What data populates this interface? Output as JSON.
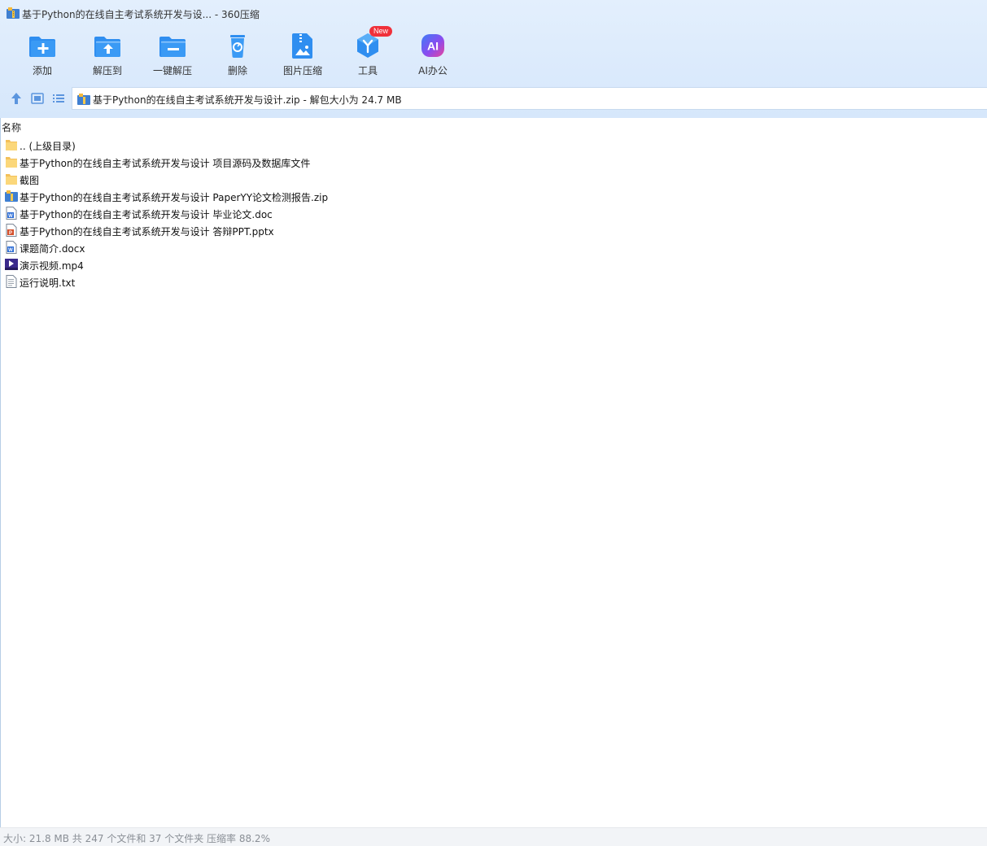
{
  "window": {
    "title": "基于Python的在线自主考试系统开发与设... - 360压缩",
    "app_icon": "zip-archive-icon"
  },
  "toolbar": {
    "add": "添加",
    "extract_to": "解压到",
    "one_click_extract": "一键解压",
    "delete": "删除",
    "image_compress": "图片压缩",
    "tools": "工具",
    "tools_badge": "New",
    "ai_office": "AI办公",
    "ai_icon_text": "AI"
  },
  "address": {
    "path": "基于Python的在线自主考试系统开发与设计.zip - 解包大小为 24.7 MB"
  },
  "list": {
    "column_name": "名称",
    "files": [
      {
        "name": ".. (上级目录)",
        "icon": "folder-icon"
      },
      {
        "name": "基于Python的在线自主考试系统开发与设计 项目源码及数据库文件",
        "icon": "folder-icon"
      },
      {
        "name": "截图",
        "icon": "folder-icon"
      },
      {
        "name": "基于Python的在线自主考试系统开发与设计 PaperYY论文检测报告.zip",
        "icon": "zip-icon"
      },
      {
        "name": "基于Python的在线自主考试系统开发与设计 毕业论文.doc",
        "icon": "word-doc-icon"
      },
      {
        "name": "基于Python的在线自主考试系统开发与设计 答辩PPT.pptx",
        "icon": "powerpoint-icon"
      },
      {
        "name": "课题简介.docx",
        "icon": "word-docx-icon"
      },
      {
        "name": "演示视频.mp4",
        "icon": "video-icon"
      },
      {
        "name": "运行说明.txt",
        "icon": "text-file-icon"
      }
    ]
  },
  "status": {
    "text": "大小: 21.8 MB 共 247 个文件和 37 个文件夹 压缩率 88.2%"
  },
  "colors": {
    "accent_blue": "#2f8ef0",
    "new_badge": "#f0303a",
    "toolbar_bg": "#dbe9fb"
  }
}
